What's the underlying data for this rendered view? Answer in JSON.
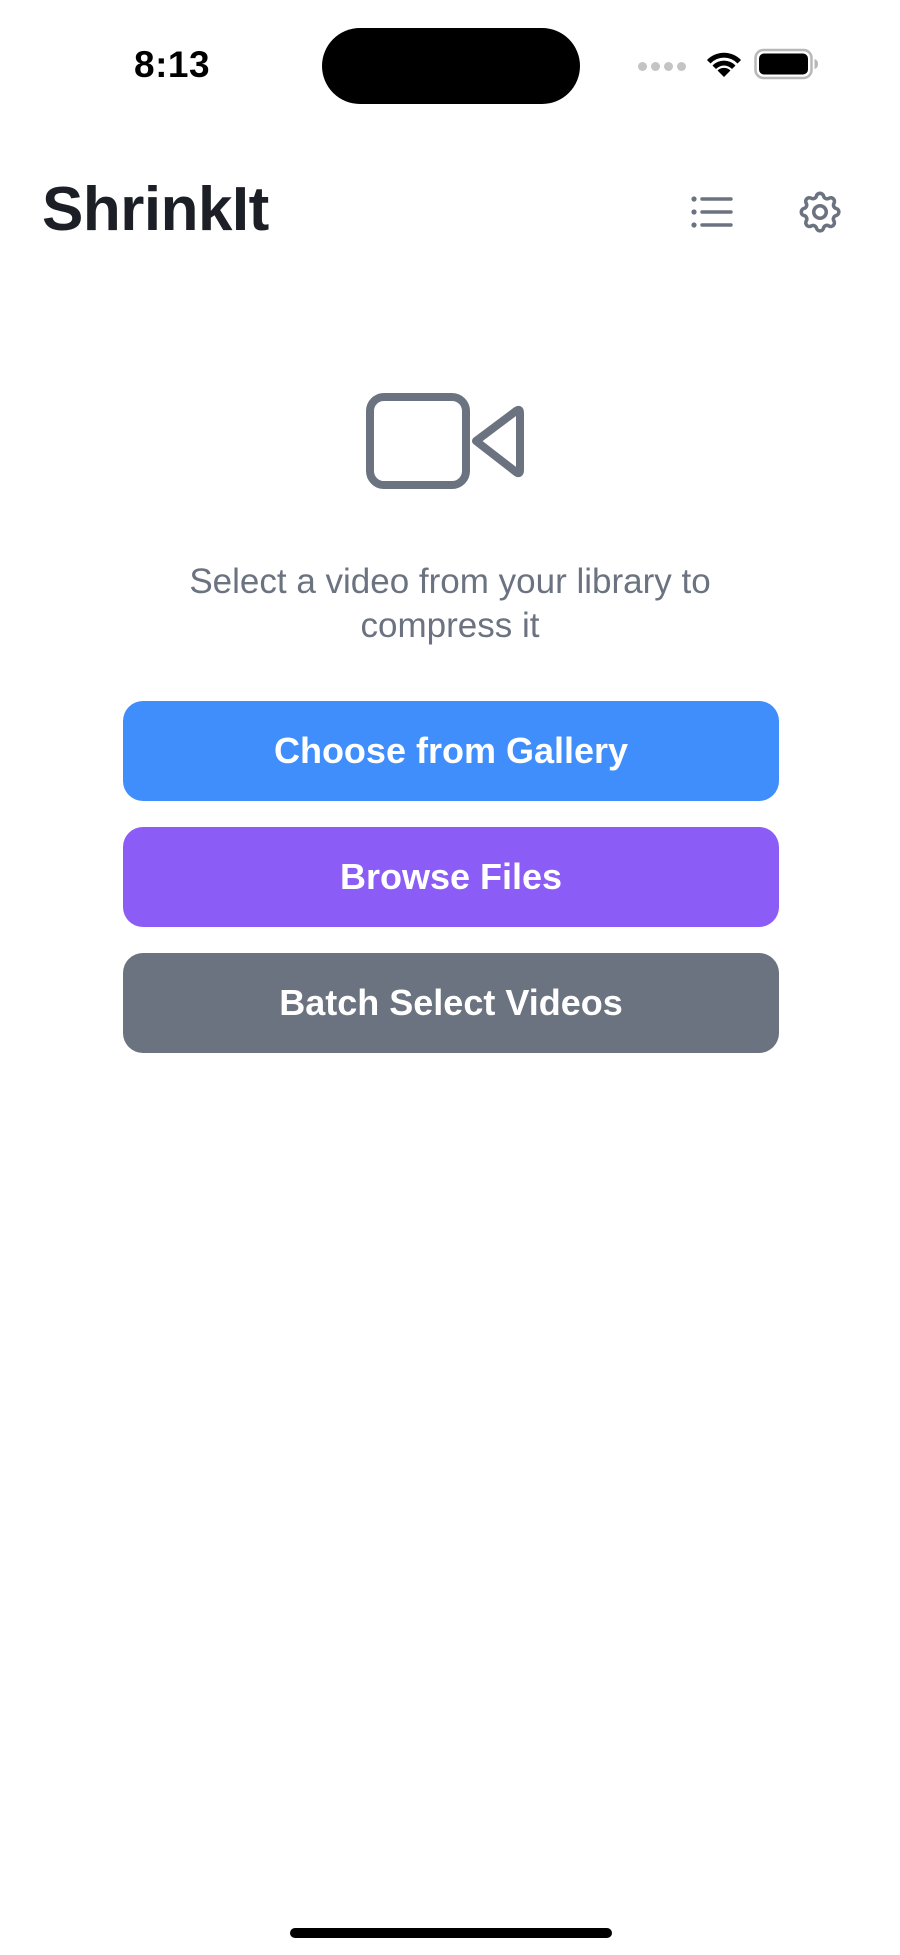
{
  "status_bar": {
    "time": "8:13"
  },
  "header": {
    "title": "ShrinkIt",
    "history_icon": "list-icon",
    "settings_icon": "gear-icon"
  },
  "main": {
    "hero_icon": "video-camera-icon",
    "prompt": "Select a video from your library to compress it",
    "buttons": [
      {
        "label": "Choose from Gallery",
        "color": "#3f8efc"
      },
      {
        "label": "Browse Files",
        "color": "#8b5cf6"
      },
      {
        "label": "Batch Select Videos",
        "color": "#6b7280"
      }
    ]
  },
  "colors": {
    "title": "#1c1f26",
    "secondary_text": "#6b7280",
    "icon": "#6b7280",
    "background": "#ffffff"
  }
}
